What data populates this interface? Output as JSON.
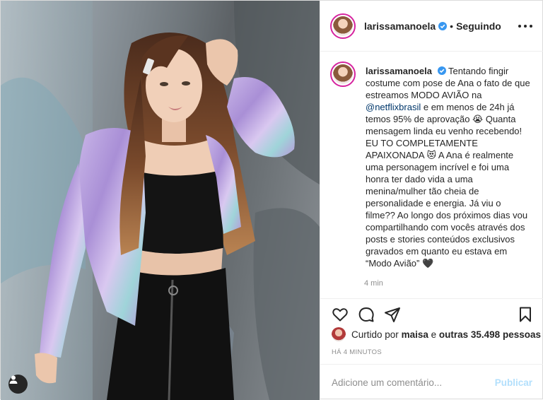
{
  "post": {
    "author": {
      "username": "larissamanoela",
      "verified_icon": "verified-badge-icon",
      "follow_separator": "•",
      "follow_status": "Seguindo"
    },
    "caption": {
      "username": "larissamanoela",
      "text_before_mention": "Tentando fingir costume com pose de Ana o fato de que estreamos MODO AVIÃO na",
      "mention": "@netflixbrasil",
      "text_after_mention": "e em menos de 24h já temos 95% de aprovação 😭 Quanta mensagem linda eu venho recebendo! EU TO COMPLETAMENTE APAIXONADA 😻 A Ana é realmente uma personagem incrível e foi uma honra ter dado vida a uma menina/mulher tão cheia de personalidade e energia. Já viu o filme?? Ao longo dos próximos dias vou compartilhando com vocês através dos posts e stories conteúdos exclusivos gravados em quanto eu estava em “Modo Avião” 🖤",
      "relative_time": "4 min"
    },
    "actions": {
      "like_icon": "heart-icon",
      "comment_icon": "comment-icon",
      "share_icon": "share-icon",
      "save_icon": "bookmark-icon"
    },
    "likes": {
      "prefix": "Curtido por",
      "first_user": "maisa",
      "middle": "e",
      "others": "outras 35.498 pessoas"
    },
    "posted_time": "HÁ 4 MINUTOS",
    "comment": {
      "placeholder": "Adicione um comentário...",
      "value": "",
      "publish_label": "Publicar"
    }
  },
  "colors": {
    "text": "#262626",
    "secondary": "#8e8e8e",
    "link": "#00376b",
    "verified": "#3897f0",
    "publish_disabled": "#b2dffc",
    "divider": "#efefef"
  }
}
